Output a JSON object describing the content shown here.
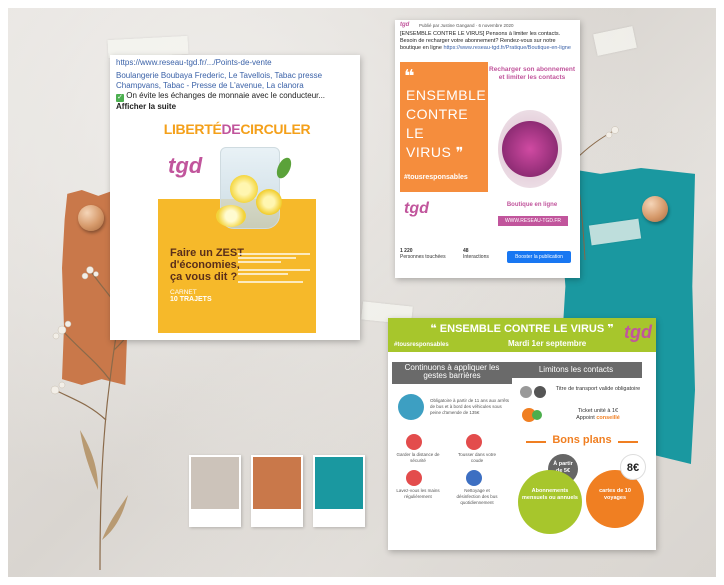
{
  "post1": {
    "link": "https://www.reseau-tgd.fr/.../Points-de-vente",
    "shops": "Boulangerie Boubaya Frederic, Le Tavellois, Tabac presse Champvans, Tabac - Presse de L'avenue, La clanora",
    "notice": "On évite les échanges de monnaie avec le conducteur...",
    "more": "Afficher la suite",
    "poster_title_a": "LIBERTÉ",
    "poster_title_b": "DE",
    "poster_title_c": "CIRCULER",
    "logo": "tgd",
    "zest_1": "Faire un ZEST",
    "zest_2": "d'économies,",
    "zest_3": "ça vous dit ?",
    "carnet_1": "CARNET",
    "carnet_2": "10 TRAJETS"
  },
  "post2": {
    "header": "Publié par Justine Gangand · 6 novembre 2020",
    "logo_small": "tgd",
    "body": "[ENSEMBLE CONTRE LE VIRUS] Pensons à limiter les contacts. Besoin de recharger votre abonnement? Rendez-vous sur notre boutique en ligne",
    "link": "https://www.reseau-tgd.fr/Pratique/Boutique-en-ligne",
    "quote": "❝",
    "big_1": "ENSEMBLE",
    "big_2": "CONTRE LE",
    "big_3": "VIRUS ❞",
    "hashtag": "#tousresponsables",
    "logo": "tgd",
    "right_title": "Recharger son abonnement et limiter les contacts",
    "shop_label": "Boutique en ligne",
    "shop_url": "WWW.RESEAU-TGD.FR",
    "reach_num": "1 220",
    "reach_label": "Personnes touchées",
    "interactions_num": "48",
    "interactions_label": "Interactions",
    "boost": "Booster la publication"
  },
  "post3": {
    "title": "❝ ENSEMBLE CONTRE LE VIRUS ❞",
    "hashtag": "#tousresponsables",
    "date": "Mardi 1er septembre",
    "logo": "tgd",
    "box_left_1": "Continuons à appliquer les",
    "box_left_2": "gestes barrières",
    "box_right": "Limitons les contacts",
    "mask_text": "Obligatoire à partir de 11 ans aux arrêts de bus et à bord des véhicules sous peine d'amende de 135€",
    "ticket_1": "Titre de transport valide obligatoire",
    "ticket_2a": "Ticket unité à 1€",
    "ticket_2b": "Appoint",
    "ticket_2c": "conseillé",
    "gesture_1": "Garder la distance de sécurité",
    "gesture_2": "Tousser dans votre coude",
    "gesture_3": "Lavez-vous les mains régulièrement",
    "gesture_4": "Nettoyage et désinfection des bus quotidiennement",
    "bons": "Bons plans",
    "bubble_grey_1": "À partir",
    "bubble_grey_2": "de 5€",
    "bubble_green_1": "Abonnements",
    "bubble_green_2": "mensuels ou annuels",
    "bubble_orange_price": "8€",
    "bubble_orange_1": "cartes de 10",
    "bubble_orange_2": "voyages"
  },
  "colors": {
    "orange": "#c9784a",
    "teal": "#1a98a0",
    "beige": "#ccc3ba",
    "magenta": "#c1559c",
    "lime": "#a7c62c",
    "flat_orange": "#f58d3d"
  }
}
